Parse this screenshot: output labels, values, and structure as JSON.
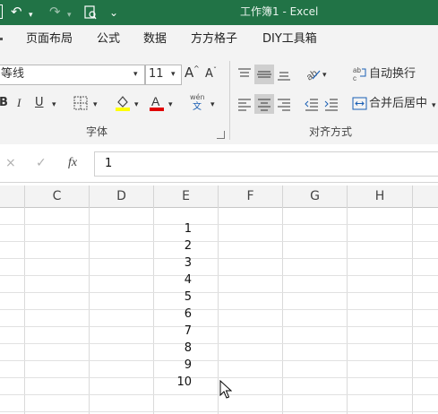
{
  "titlebar": {
    "title": "工作簿1  -  Excel",
    "undo_icon": "↶",
    "redo_icon": "↷",
    "customize_icon": "⌄"
  },
  "tabs": [
    {
      "label": "页面布局"
    },
    {
      "label": "公式"
    },
    {
      "label": "数据"
    },
    {
      "label": "方方格子"
    },
    {
      "label": "DIY工具箱"
    }
  ],
  "ribbon": {
    "font_name": "等线",
    "font_size": "11",
    "grow_font": "A",
    "shrink_font": "A",
    "bold": "B",
    "italic": "I",
    "underline": "U",
    "phonetic_top": "wén",
    "phonetic_bottom": "文",
    "font_group_label": "字体",
    "wrap_text": "自动换行",
    "merge_center": "合并后居中",
    "alignment_group_label": "对齐方式",
    "fill_color": "#ffff00",
    "font_color": "#e00000"
  },
  "formula_bar": {
    "cancel": "×",
    "confirm": "✓",
    "fx": "fx",
    "value": "1"
  },
  "sheet": {
    "columns": [
      "C",
      "D",
      "E",
      "F",
      "G",
      "H"
    ],
    "column_e_values": [
      "1",
      "2",
      "3",
      "4",
      "5",
      "6",
      "7",
      "8",
      "9",
      "10"
    ]
  }
}
